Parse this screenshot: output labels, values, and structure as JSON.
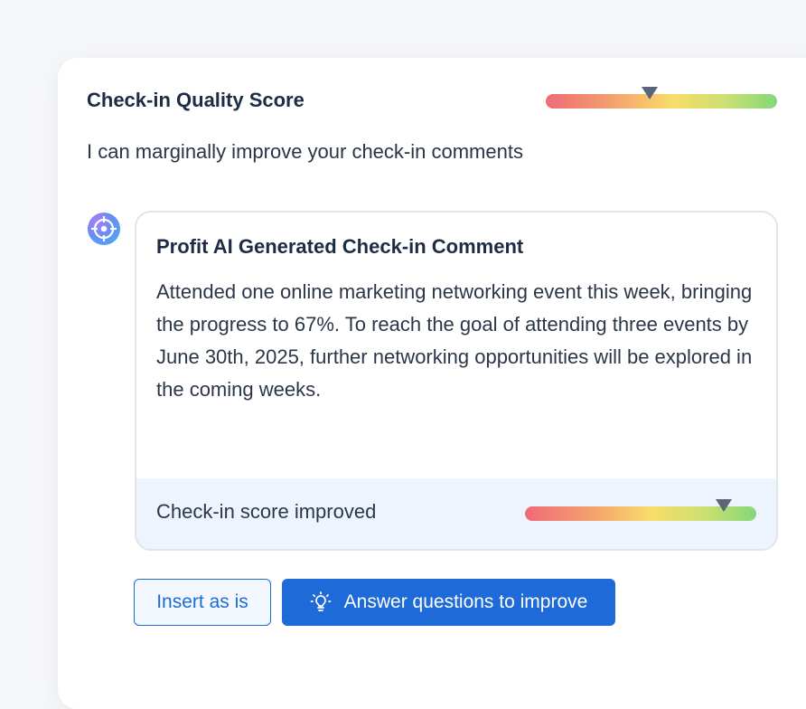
{
  "quality": {
    "title": "Check-in Quality Score",
    "subtitle": "I can marginally improve your check-in comments",
    "meter_level": 0.45
  },
  "suggestion": {
    "title": "Profit AI Generated Check-in Comment",
    "body": "Attended one online marketing networking event this week, bringing the progress to 67%. To reach the goal of attending three events by June 30th, 2025, further networking opportunities will be explored in the coming weeks.",
    "footer_label": "Check-in score improved",
    "meter_level": 0.86
  },
  "actions": {
    "insert_label": "Insert as is",
    "improve_label": "Answer questions to improve"
  },
  "icons": {
    "avatar": "ai-assistant-icon",
    "improve": "lightbulb-icon"
  }
}
